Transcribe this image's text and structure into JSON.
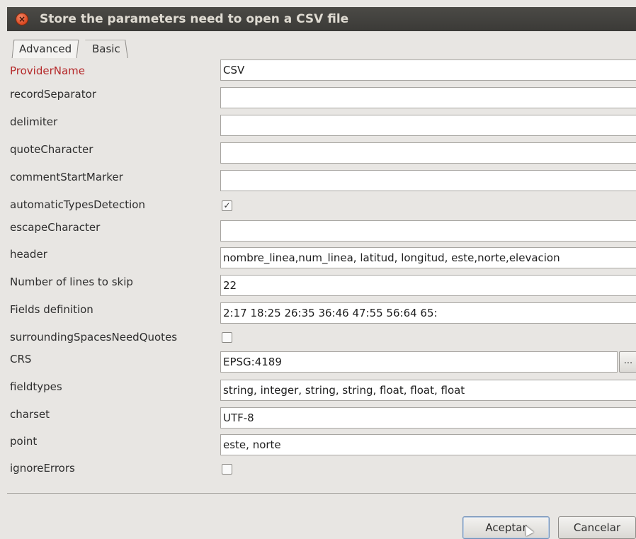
{
  "window": {
    "title": "Store the parameters need to open a CSV file",
    "close_icon": "×"
  },
  "tabs": [
    {
      "label": "Advanced",
      "selected": true
    },
    {
      "label": "Basic",
      "selected": false
    }
  ],
  "form": {
    "providerName": {
      "label": "ProviderName",
      "value": "CSV"
    },
    "recordSeparator": {
      "label": "recordSeparator",
      "value": ""
    },
    "delimiter": {
      "label": "delimiter",
      "value": ""
    },
    "quoteCharacter": {
      "label": "quoteCharacter",
      "value": ""
    },
    "commentStartMarker": {
      "label": "commentStartMarker",
      "value": ""
    },
    "automaticTypesDetection": {
      "label": "automaticTypesDetection",
      "checked": true,
      "mark": "✓"
    },
    "escapeCharacter": {
      "label": "escapeCharacter",
      "value": ""
    },
    "header": {
      "label": "header",
      "value": "nombre_linea,num_linea, latitud, longitud, este,norte,elevacion"
    },
    "linesToSkip": {
      "label": "Number of lines to skip",
      "value": "22"
    },
    "fieldsDefinition": {
      "label": "Fields definition",
      "value": "2:17 18:25 26:35 36:46 47:55 56:64 65:"
    },
    "surroundingSpacesNeedQuotes": {
      "label": "surroundingSpacesNeedQuotes",
      "checked": false
    },
    "crs": {
      "label": "CRS",
      "value": "EPSG:4189",
      "browse_label": "..."
    },
    "fieldtypes": {
      "label": "fieldtypes",
      "value": "string, integer, string, string, float, float, float"
    },
    "charset": {
      "label": "charset",
      "value": "UTF-8"
    },
    "point": {
      "label": "point",
      "value": "este, norte"
    },
    "ignoreErrors": {
      "label": "ignoreErrors",
      "checked": false
    }
  },
  "buttons": {
    "accept": "Aceptar",
    "cancel": "Cancelar"
  },
  "colors": {
    "required_label": "#b5292a",
    "titlebar": "#3b3a37",
    "background": "#e8e6e3"
  }
}
